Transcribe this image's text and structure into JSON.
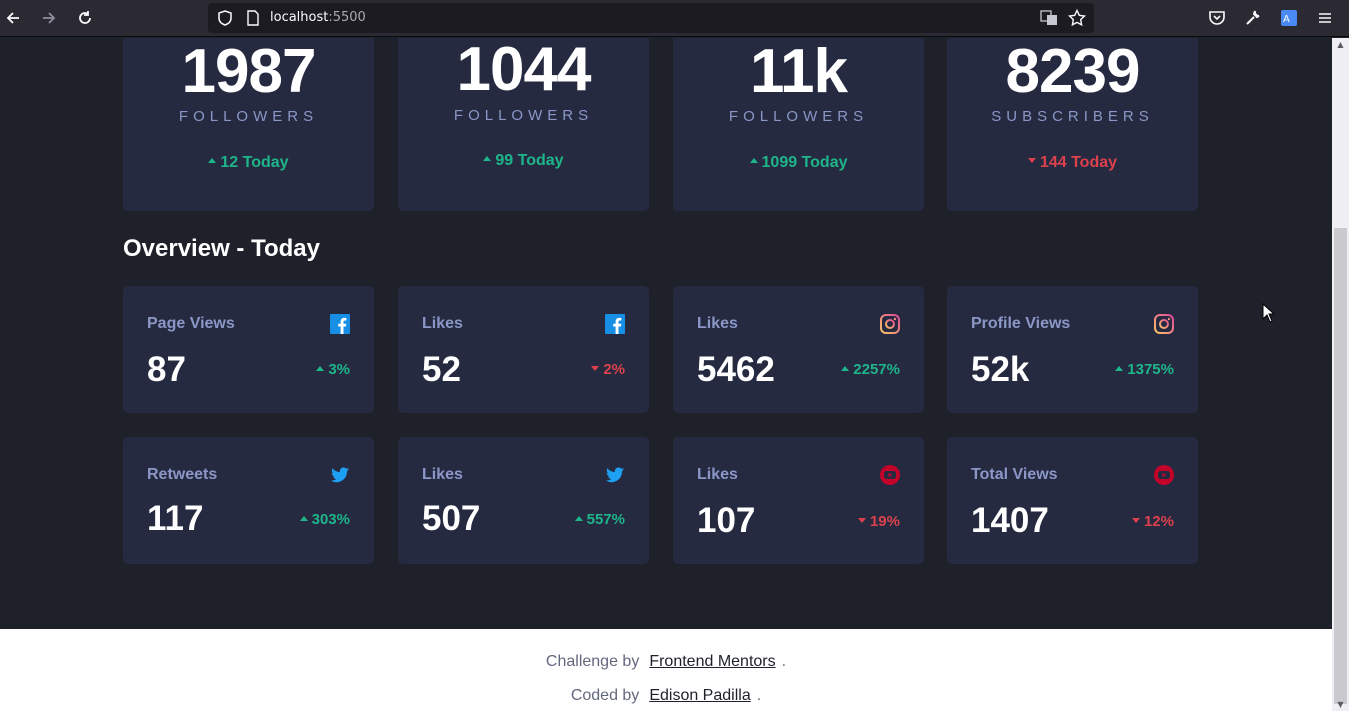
{
  "browser": {
    "url_host": "localhost",
    "url_port": ":5500"
  },
  "top_cards": [
    {
      "number": "1987",
      "label": "FOLLOWERS",
      "today": "12 Today",
      "trend": "up"
    },
    {
      "number": "1044",
      "label": "FOLLOWERS",
      "today": "99 Today",
      "trend": "up"
    },
    {
      "number": "11k",
      "label": "FOLLOWERS",
      "today": "1099 Today",
      "trend": "up"
    },
    {
      "number": "8239",
      "label": "SUBSCRIBERS",
      "today": "144 Today",
      "trend": "down"
    }
  ],
  "overview": {
    "title": "Overview - Today",
    "cards": [
      {
        "title": "Page Views",
        "value": "87",
        "percent": "3%",
        "trend": "up",
        "icon": "facebook-icon"
      },
      {
        "title": "Likes",
        "value": "52",
        "percent": "2%",
        "trend": "down",
        "icon": "facebook-icon"
      },
      {
        "title": "Likes",
        "value": "5462",
        "percent": "2257%",
        "trend": "up",
        "icon": "instagram-icon"
      },
      {
        "title": "Profile Views",
        "value": "52k",
        "percent": "1375%",
        "trend": "up",
        "icon": "instagram-icon"
      },
      {
        "title": "Retweets",
        "value": "117",
        "percent": "303%",
        "trend": "up",
        "icon": "twitter-icon"
      },
      {
        "title": "Likes",
        "value": "507",
        "percent": "557%",
        "trend": "up",
        "icon": "twitter-icon"
      },
      {
        "title": "Likes",
        "value": "107",
        "percent": "19%",
        "trend": "down",
        "icon": "youtube-icon"
      },
      {
        "title": "Total Views",
        "value": "1407",
        "percent": "12%",
        "trend": "down",
        "icon": "youtube-icon"
      }
    ]
  },
  "footer": {
    "challenge_prefix": "Challenge by",
    "challenge_link": "Frontend Mentors",
    "challenge_suffix": ".",
    "coded_prefix": "Coded by",
    "coded_link": "Edison Padilla",
    "coded_suffix": "."
  },
  "colors": {
    "background": "#1e202a",
    "card": "#252a41",
    "up": "#1eb589",
    "down": "#dc414c",
    "facebook": "#178fe5",
    "twitter": "#1da0f2",
    "youtube": "#c4032a"
  }
}
